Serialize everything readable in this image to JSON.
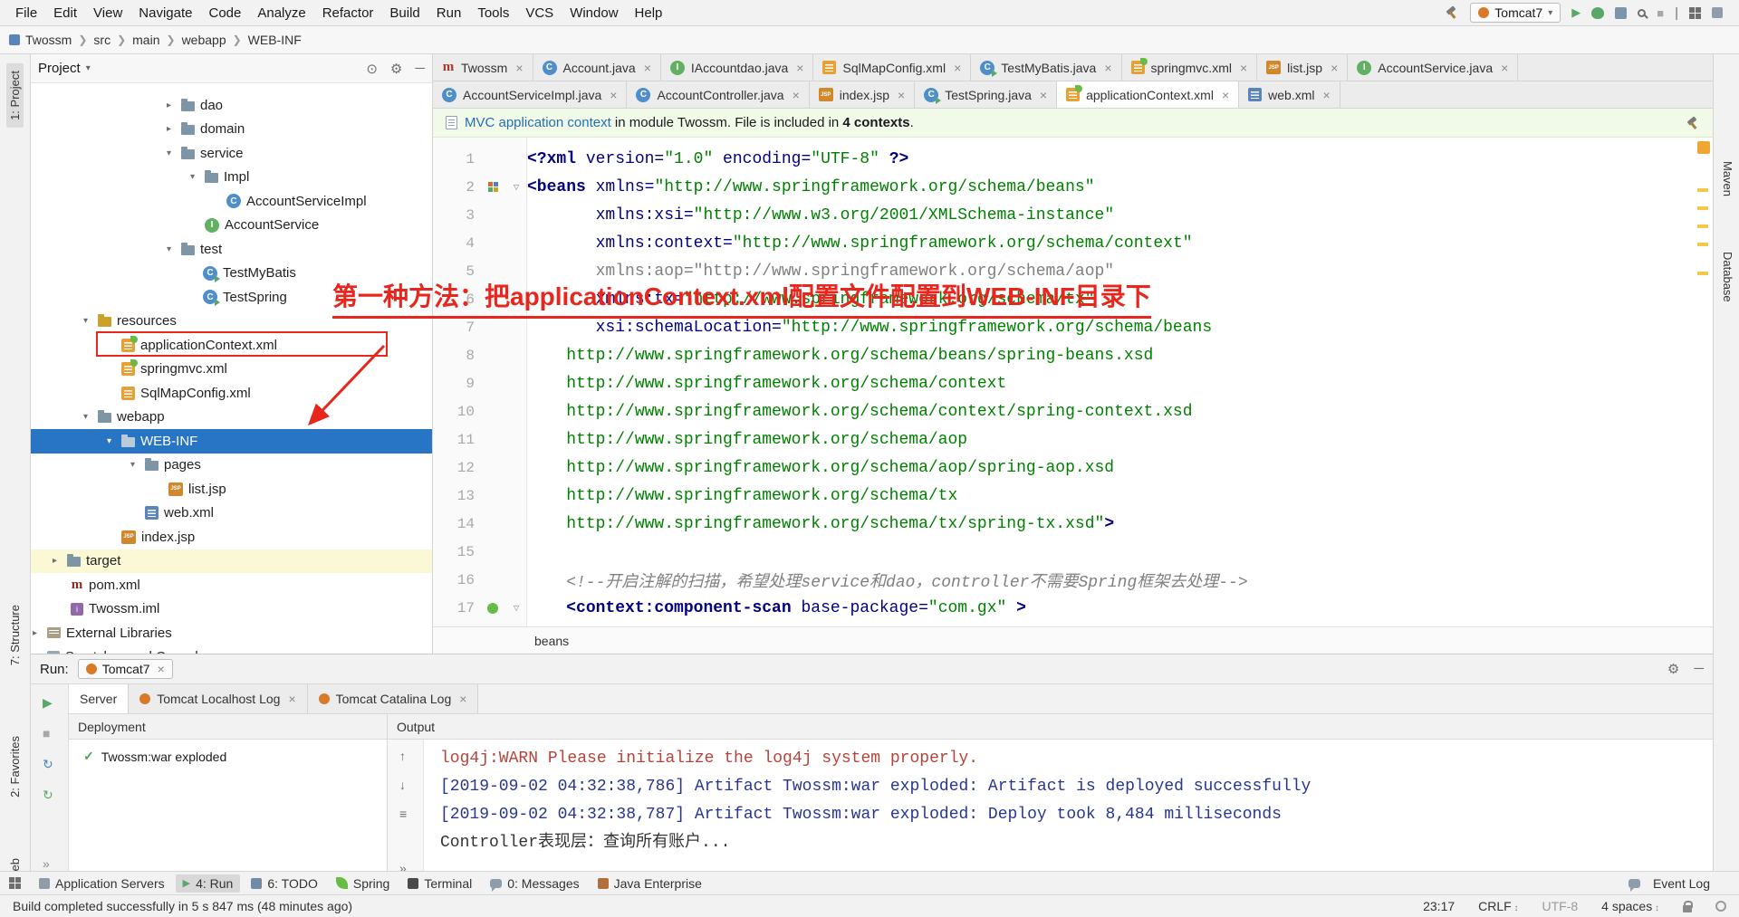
{
  "menubar": {
    "items": [
      "File",
      "Edit",
      "View",
      "Navigate",
      "Code",
      "Analyze",
      "Refactor",
      "Build",
      "Run",
      "Tools",
      "VCS",
      "Window",
      "Help"
    ]
  },
  "navbar": {
    "breadcrumbs": [
      "Twossm",
      "src",
      "main",
      "webapp",
      "WEB-INF"
    ],
    "run_config": "Tomcat7"
  },
  "stripes": {
    "left_top": "1: Project",
    "left_bottom": [
      "7: Structure",
      "2: Favorites",
      "Web"
    ],
    "right": [
      "Maven",
      "Database"
    ]
  },
  "project_panel": {
    "title": "Project",
    "tree": [
      "dao",
      "domain",
      "service",
      "Impl",
      "AccountServiceImpl",
      "AccountService",
      "test",
      "TestMyBatis",
      "TestSpring",
      "resources",
      "applicationContext.xml",
      "springmvc.xml",
      "SqlMapConfig.xml",
      "webapp",
      "WEB-INF",
      "pages",
      "list.jsp",
      "web.xml",
      "index.jsp",
      "target",
      "pom.xml",
      "Twossm.iml",
      "External Libraries",
      "Scratches and Consoles"
    ]
  },
  "tabs_row1": [
    "Twossm",
    "Account.java",
    "IAccountdao.java",
    "SqlMapConfig.xml",
    "TestMyBatis.java",
    "springmvc.xml",
    "list.jsp",
    "AccountService.java"
  ],
  "tabs_row2": [
    "AccountServiceImpl.java",
    "AccountController.java",
    "index.jsp",
    "TestSpring.java",
    "applicationContext.xml",
    "web.xml"
  ],
  "notification": {
    "link": "MVC application context",
    "middle": " in module Twossm. File is included in ",
    "strong": "4 contexts",
    "end": "."
  },
  "editor": {
    "breadcrumb": "beans",
    "nums": [
      "1",
      "2",
      "3",
      "4",
      "5",
      "6",
      "7",
      "8",
      "9",
      "10",
      "11",
      "12",
      "13",
      "14",
      "15",
      "16",
      "17"
    ],
    "lines": [
      [
        "<?xml ",
        "version=",
        "\"1.0\" ",
        "encoding=",
        "\"UTF-8\" ",
        "?>"
      ],
      [
        "<beans ",
        "xmlns=",
        "\"http://www.springframework.org/schema/beans\""
      ],
      [
        "       ",
        "xmlns:xsi=",
        "\"http://www.w3.org/2001/XMLSchema-instance\""
      ],
      [
        "       ",
        "xmlns:context=",
        "\"http://www.springframework.org/schema/context\""
      ],
      [
        "       xmlns:aop=\"http://www.springframework.org/schema/aop\""
      ],
      [
        "       ",
        "xmlns:tx=",
        "\"http://www.springframework.org/schema/tx\""
      ],
      [
        "       ",
        "xsi:schemaLocation=",
        "\"http://www.springframework.org/schema/beans"
      ],
      [
        "    http://www.springframework.org/schema/beans/spring-beans.xsd"
      ],
      [
        "    http://www.springframework.org/schema/context"
      ],
      [
        "    http://www.springframework.org/schema/context/spring-context.xsd"
      ],
      [
        "    http://www.springframework.org/schema/aop"
      ],
      [
        "    http://www.springframework.org/schema/aop/spring-aop.xsd"
      ],
      [
        "    http://www.springframework.org/schema/tx"
      ],
      [
        "    http://www.springframework.org/schema/tx/spring-tx.xsd\"",
        ">"
      ],
      [
        ""
      ],
      [
        "    <!--开启注解的扫描，希望处理service和dao，controller不需要Spring框架去处理-->"
      ],
      [
        "    ",
        "<context:component-scan ",
        "base-package=",
        "\"com.gx\" ",
        ">"
      ]
    ]
  },
  "annotation": {
    "title": "第一种方法：把applicationContext.xml配置文件配置到WEB-INF目录下"
  },
  "run_panel": {
    "label": "Run:",
    "config_tab": "Tomcat7",
    "tabs": [
      "Server",
      "Tomcat Localhost Log",
      "Tomcat Catalina Log"
    ],
    "deployment_header": "Deployment",
    "deployment_items": [
      "Twossm:war exploded"
    ],
    "output_header": "Output",
    "log": [
      "log4j:WARN Please initialize the log4j system properly.",
      "[2019-09-02 04:32:38,786] Artifact Twossm:war exploded: Artifact is deployed successfully",
      "[2019-09-02 04:32:38,787] Artifact Twossm:war exploded: Deploy took 8,484 milliseconds",
      "Controller表现层：查询所有账户..."
    ]
  },
  "bottom_bar": {
    "left": [
      "Application Servers",
      "4: Run",
      "6: TODO",
      "Spring",
      "Terminal",
      "0: Messages",
      "Java Enterprise"
    ],
    "right": [
      "Event Log"
    ]
  },
  "status_bar": {
    "message": "Build completed successfully in 5 s 847 ms (48 minutes ago)",
    "position": "23:17",
    "line_ending": "CRLF",
    "encoding": "UTF-8",
    "indent": "4 spaces"
  },
  "colors": {
    "selection": "#2874C5",
    "annotation_red": "#E8261D",
    "link_blue": "#2470B3"
  }
}
